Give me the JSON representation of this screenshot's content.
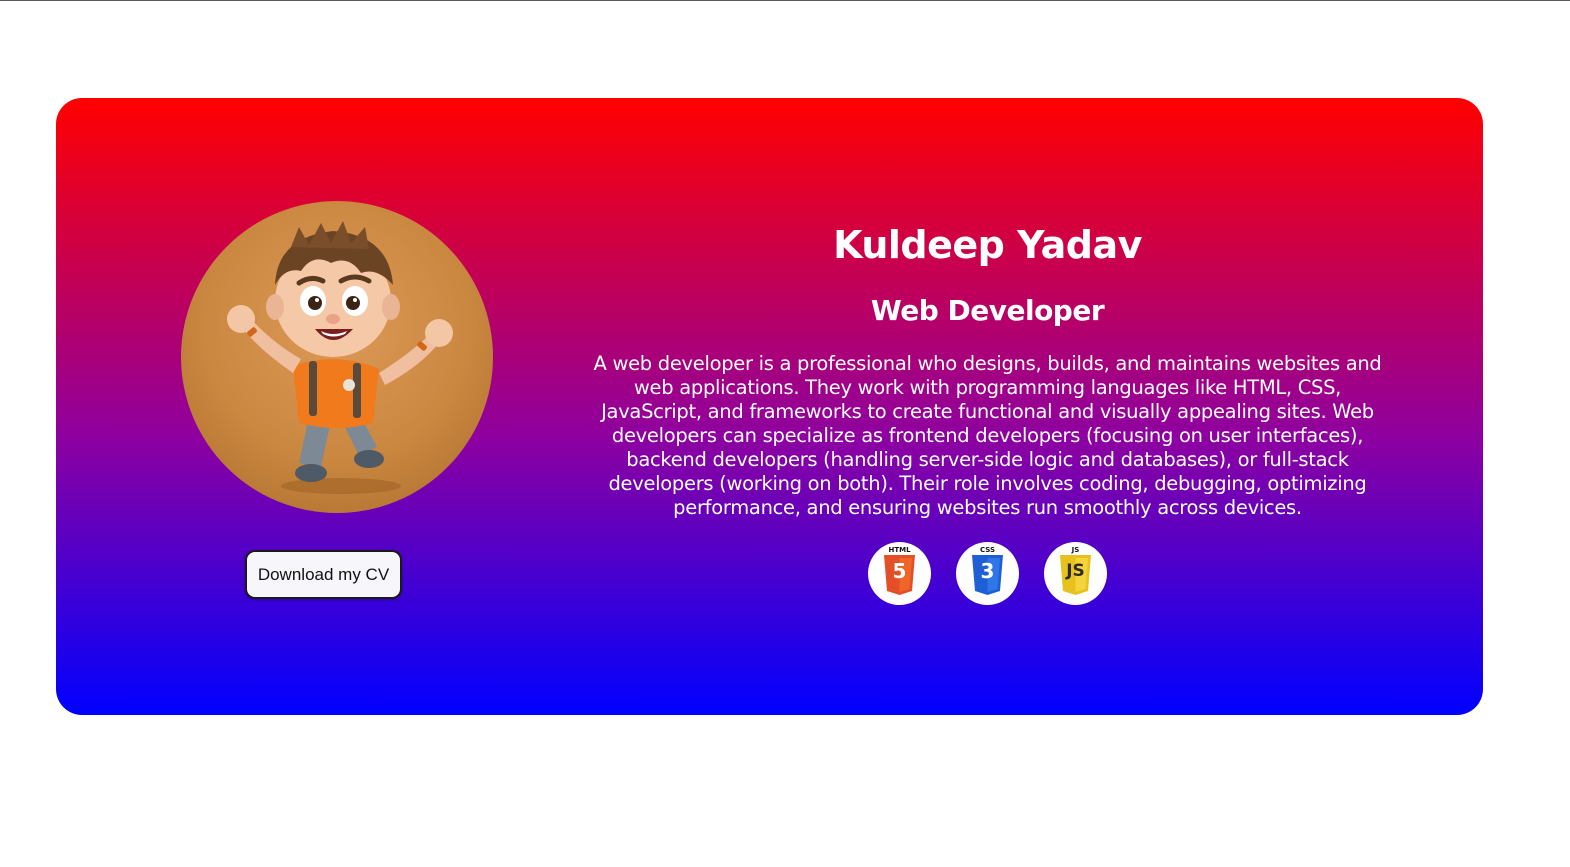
{
  "profile": {
    "name": "Kuldeep Yadav",
    "role": "Web Developer",
    "bio": "A web developer is a professional who designs, builds, and maintains websites and web applications. They work with programming languages like HTML, CSS, JavaScript, and frameworks to create functional and visually appealing sites. Web developers can specialize as frontend developers (focusing on user interfaces), backend developers (handling server-side logic and databases), or full-stack developers (working on both). Their role involves coding, debugging, optimizing performance, and ensuring websites run smoothly across devices.",
    "avatar_icon": "cartoon-boy-avatar",
    "download_button_label": "Download my CV"
  },
  "skills": [
    {
      "name": "HTML",
      "glyph": "5",
      "icon": "html5-icon",
      "color": "#e34f26"
    },
    {
      "name": "CSS",
      "glyph": "3",
      "icon": "css3-icon",
      "color": "#1572b6"
    },
    {
      "name": "JS",
      "glyph": "JS",
      "icon": "javascript-icon",
      "color": "#f0db4f"
    }
  ],
  "theme": {
    "gradient_top": "#ff0000",
    "gradient_mid": "#8e00a0",
    "gradient_bottom": "#0000ff",
    "text_color": "#ffffff"
  }
}
